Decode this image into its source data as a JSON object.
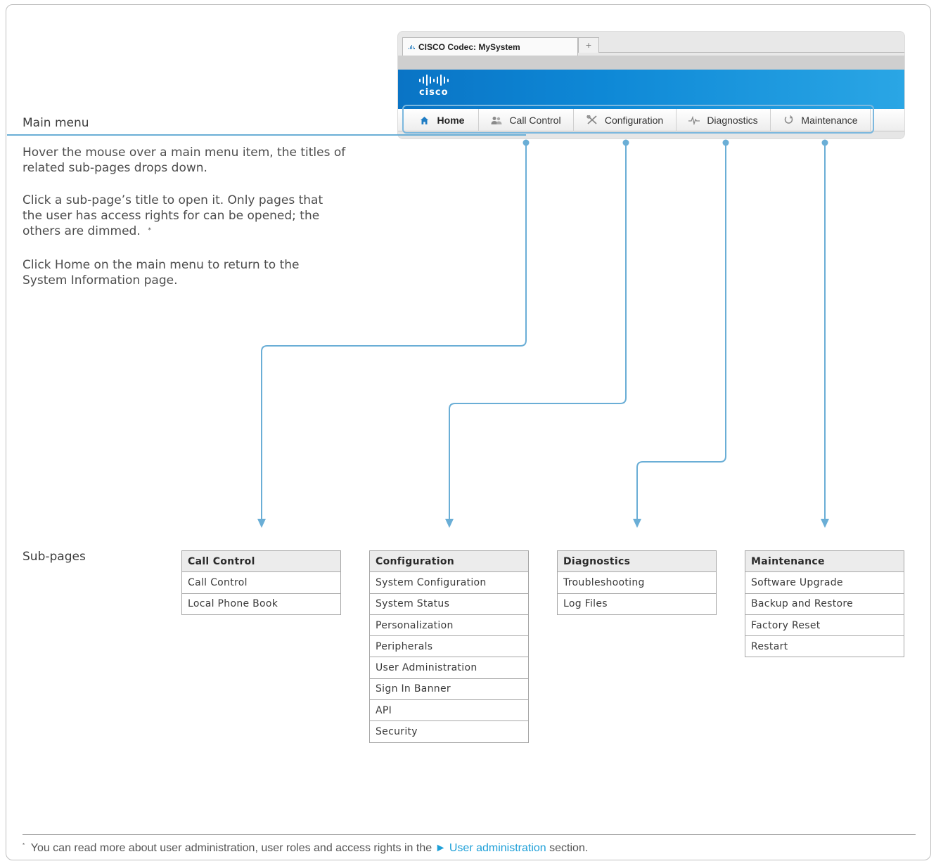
{
  "browser": {
    "tab_title": "CISCO Codec: MySystem",
    "new_tab_symbol": "+",
    "logo_text": "cisco",
    "menu": [
      {
        "label": "Home",
        "icon": "home-icon"
      },
      {
        "label": "Call Control",
        "icon": "users-icon"
      },
      {
        "label": "Configuration",
        "icon": "tools-icon"
      },
      {
        "label": "Diagnostics",
        "icon": "pulse-icon"
      },
      {
        "label": "Maintenance",
        "icon": "refresh-icon"
      }
    ]
  },
  "main_menu": {
    "heading": "Main menu",
    "paragraphs": [
      "Hover the mouse over a main menu item, the titles of related sub-pages drops down.",
      "Click a sub-page’s title to open it. Only pages that the user has access rights for can be opened; the others are dimmed.",
      "Click Home on the main menu to return to the System Information page."
    ],
    "footnote_marker": "*"
  },
  "sub_pages": {
    "heading": "Sub-pages",
    "tables": [
      {
        "title": "Call Control",
        "items": [
          "Call Control",
          "Local Phone Book"
        ]
      },
      {
        "title": "Configuration",
        "items": [
          "System Configuration",
          "System Status",
          "Personalization",
          "Peripherals",
          "User Administration",
          "Sign In Banner",
          "API",
          "Security"
        ]
      },
      {
        "title": "Diagnostics",
        "items": [
          "Troubleshooting",
          "Log Files"
        ]
      },
      {
        "title": "Maintenance",
        "items": [
          "Software Upgrade",
          "Backup and Restore",
          "Factory Reset",
          "Restart"
        ]
      }
    ]
  },
  "footer": {
    "marker": "*",
    "text_before": "You can read more about user administration, user roles and access rights in the",
    "link_arrow": "►",
    "link_text": "User administration",
    "text_after": "section."
  },
  "colors": {
    "connector": "#6aaed6",
    "link": "#1fa0d8",
    "cisco_blue": "#0e88d6"
  }
}
